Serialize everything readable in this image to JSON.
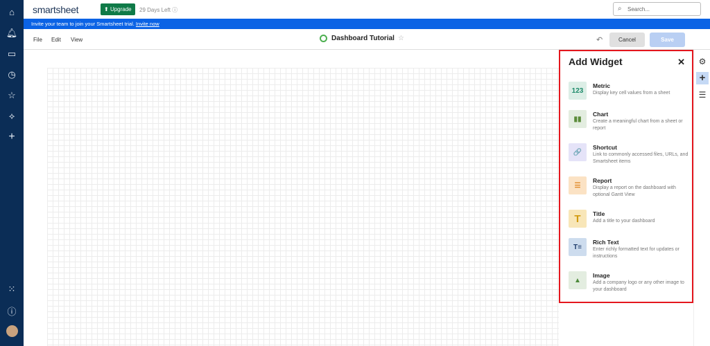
{
  "sidebar": {
    "icons": [
      "home-icon",
      "bell-icon",
      "folder-icon",
      "clock-icon",
      "star-icon",
      "solutions-icon",
      "plus-icon",
      "apps-icon",
      "help-icon",
      "avatar"
    ]
  },
  "header": {
    "logo": "smartsheet",
    "upgrade": "Upgrade",
    "trial": "29 Days Left",
    "search_placeholder": "Search..."
  },
  "banner": {
    "text": "Invite your team to join your Smartsheet trial.",
    "link": "Invite now"
  },
  "toolbar": {
    "menus": [
      "File",
      "Edit",
      "View"
    ],
    "title": "Dashboard Tutorial",
    "cancel": "Cancel",
    "save": "Save"
  },
  "panel": {
    "title": "Add Widget",
    "widgets": [
      {
        "name": "Metric",
        "desc": "Display key cell values from a sheet",
        "icon": "123"
      },
      {
        "name": "Chart",
        "desc": "Create a meaningful chart from a sheet or report",
        "icon": "▮▮"
      },
      {
        "name": "Shortcut",
        "desc": "Link to commonly accessed files, URLs, and Smartsheet items",
        "icon": "🔗"
      },
      {
        "name": "Report",
        "desc": "Display a report on the dashboard with optional Gantt View",
        "icon": "☰"
      },
      {
        "name": "Title",
        "desc": "Add a title to your dashboard",
        "icon": "T"
      },
      {
        "name": "Rich Text",
        "desc": "Enter richly formatted text for updates or instructions",
        "icon": "T≡"
      },
      {
        "name": "Image",
        "desc": "Add a company logo or any other image to your dashboard",
        "icon": "▲"
      }
    ]
  }
}
